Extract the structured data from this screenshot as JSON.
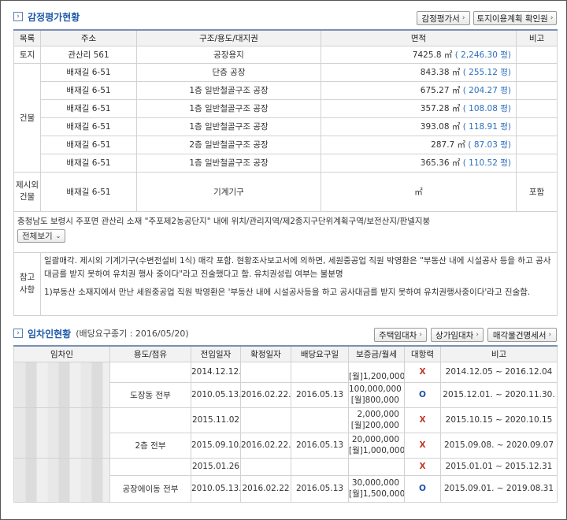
{
  "appraisal": {
    "title": "감정평가현황",
    "btn_appraisal": "감정평가서",
    "btn_land_use": "토지이용계획 확인원",
    "headers": [
      "목록",
      "주소",
      "구조/용도/대지권",
      "면적",
      "비고"
    ],
    "land": {
      "category": "토지",
      "address": "관산리 561",
      "use": "공장용지",
      "area": "7425.8 ㎡",
      "pyeong": "( 2,246.30 평)",
      "note": ""
    },
    "building_category": "건물",
    "buildings": [
      {
        "address": "배재길 6-51",
        "use": "단층 공장",
        "area": "843.38 ㎡",
        "pyeong": "( 255.12 평)"
      },
      {
        "address": "배재길 6-51",
        "use": "1층 일반철골구조 공장",
        "area": "675.27 ㎡",
        "pyeong": "( 204.27 평)"
      },
      {
        "address": "배재길 6-51",
        "use": "1층 일반철골구조 공장",
        "area": "357.28 ㎡",
        "pyeong": "( 108.08 평)"
      },
      {
        "address": "배재길 6-51",
        "use": "1층 일반철골구조 공장",
        "area": "393.08 ㎡",
        "pyeong": "( 118.91 평)"
      },
      {
        "address": "배재길 6-51",
        "use": "2층 일반철골구조 공장",
        "area": "287.7 ㎡",
        "pyeong": "( 87.03 평)"
      },
      {
        "address": "배재길 6-51",
        "use": "1층 일반철골구조 공장",
        "area": "365.36 ㎡",
        "pyeong": "( 110.52 평)"
      }
    ],
    "excluded": {
      "category": "제시외건물",
      "address": "배재길 6-51",
      "use": "기계기구",
      "area": "㎡",
      "note": "포함"
    },
    "location_text": "충청남도 보령시 주포면 관산리 소재 \"주포제2농공단지\" 내에 위치/관리지역/제2종지구단위계획구역/보전산지/판넬지붕",
    "view_all": "전체보기",
    "ref_label": "참고사항",
    "ref_text_1": "일괄매각. 제시외 기계기구(수변전설비 1식) 매각 포함. 현황조사보고서에 의하면, 세원중공업 직원 박영환은 \"부동산 내에 시설공사 등을 하고 공사대금를 받지 못하여 유치권 행사 중이다\"라고 진술했다고 함. 유치권성립 여부는 불분명",
    "ref_text_2": "1)부동산 소재지에서 만난 세원중공업 직원 박영환은 '부동산 내에 시설공사등을 하고 공사대금를 받지 못하여 유치권행사중이다'라고 진술함."
  },
  "tenant": {
    "title": "임차인현황",
    "subtitle": "(배당요구종기 : 2016/05/20)",
    "btn_lease": "주택임대차",
    "btn_shop": "상가임대차",
    "btn_statement": "매각물건명세서",
    "headers": [
      "임차인",
      "용도/점유",
      "전입일자",
      "확정일자",
      "배당요구일",
      "보증금/월세",
      "대항력",
      "비고"
    ],
    "rows": [
      {
        "use": "",
        "move_in": "2014.12.12.",
        "fixed": "",
        "dividend": "",
        "deposit1": "",
        "deposit2": "[월]1,200,000",
        "power": "X",
        "note": "2014.12.05 ~ 2016.12.04"
      },
      {
        "use": "도장동 전부",
        "move_in": "2010.05.13.",
        "fixed": "2016.02.22.",
        "dividend": "2016.05.13",
        "deposit1": "100,000,000",
        "deposit2": "[월]800,000",
        "power": "O",
        "note": "2015.12.01. ~ 2020.11.30."
      },
      {
        "use": "",
        "move_in": "2015.11.02",
        "fixed": "",
        "dividend": "",
        "deposit1": "2,000,000",
        "deposit2": "[월]200,000",
        "power": "X",
        "note": "2015.10.15 ~ 2020.10.15"
      },
      {
        "use": "2층 전부",
        "move_in": "2015.09.10.",
        "fixed": "2016.02.22.",
        "dividend": "2016.05.13",
        "deposit1": "20,000,000",
        "deposit2": "[월]1,000,000",
        "power": "X",
        "note": "2015.09.08. ~ 2020.09.07"
      },
      {
        "use": "",
        "move_in": "2015.01.26",
        "fixed": "",
        "dividend": "",
        "deposit1": "",
        "deposit2": "",
        "power": "X",
        "note": "2015.01.01 ~ 2015.12.31"
      },
      {
        "use": "공장에이동 전부",
        "move_in": "2010.05.13.",
        "fixed": "2016.02.22",
        "dividend": "2016.05.13",
        "deposit1": "30,000,000",
        "deposit2": "[월]1,500,000",
        "power": "O",
        "note": "2015.09.01. ~ 2019.08.31"
      }
    ]
  }
}
